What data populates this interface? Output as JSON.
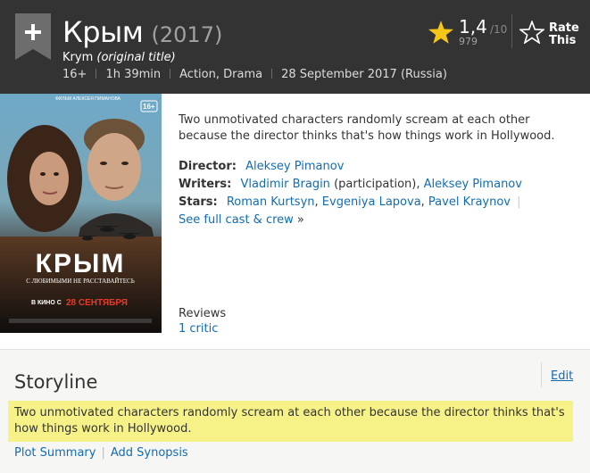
{
  "header": {
    "title": "Крым",
    "year": "(2017)",
    "original_title_name": "Krym",
    "original_title_note": "(original title)",
    "certificate": "16+",
    "runtime": "1h 39min",
    "genres": "Action, Drama",
    "release": "28 September 2017 (Russia)",
    "rating_value": "1,4",
    "rating_max": "/10",
    "rating_count": "979",
    "rate_label_1": "Rate",
    "rate_label_2": "This"
  },
  "poster": {
    "top_text": "ФИЛЬМ АЛЕКСЕЯ ПИМАНОВА",
    "age": "16+",
    "title": "КРЫМ",
    "tagline": "С ЛЮБИМЫМИ НЕ РАССТАВАЙТЕСЬ",
    "release_prefix": "В КИНО С",
    "release_date": "28 СЕНТЯБРЯ"
  },
  "summary": "Two unmotivated characters randomly scream at each other because the director thinks that's how things work in Hollywood.",
  "credits": {
    "director_label": "Director:",
    "director": "Aleksey Pimanov",
    "writers_label": "Writers:",
    "writer_1": "Vladimir Bragin",
    "writer_1_note": "(participation),",
    "writer_2": "Aleksey Pimanov",
    "stars_label": "Stars:",
    "star_1": "Roman Kurtsyn",
    "star_2": "Evgeniya Lapova",
    "star_3": "Pavel Kraynov",
    "full_cast": "See full cast & crew",
    "full_cast_arrow": "»"
  },
  "reviews": {
    "label": "Reviews",
    "critic_link": "1 critic"
  },
  "storyline": {
    "title": "Storyline",
    "edit": "Edit",
    "text": "Two unmotivated characters randomly scream at each other because the director thinks that's how things work in Hollywood.",
    "plot_summary": "Plot Summary",
    "add_synopsis": "Add Synopsis"
  },
  "colors": {
    "header_bg": "#333333",
    "link": "#136cb2",
    "star": "#f5c518",
    "highlight": "#f6f288"
  }
}
